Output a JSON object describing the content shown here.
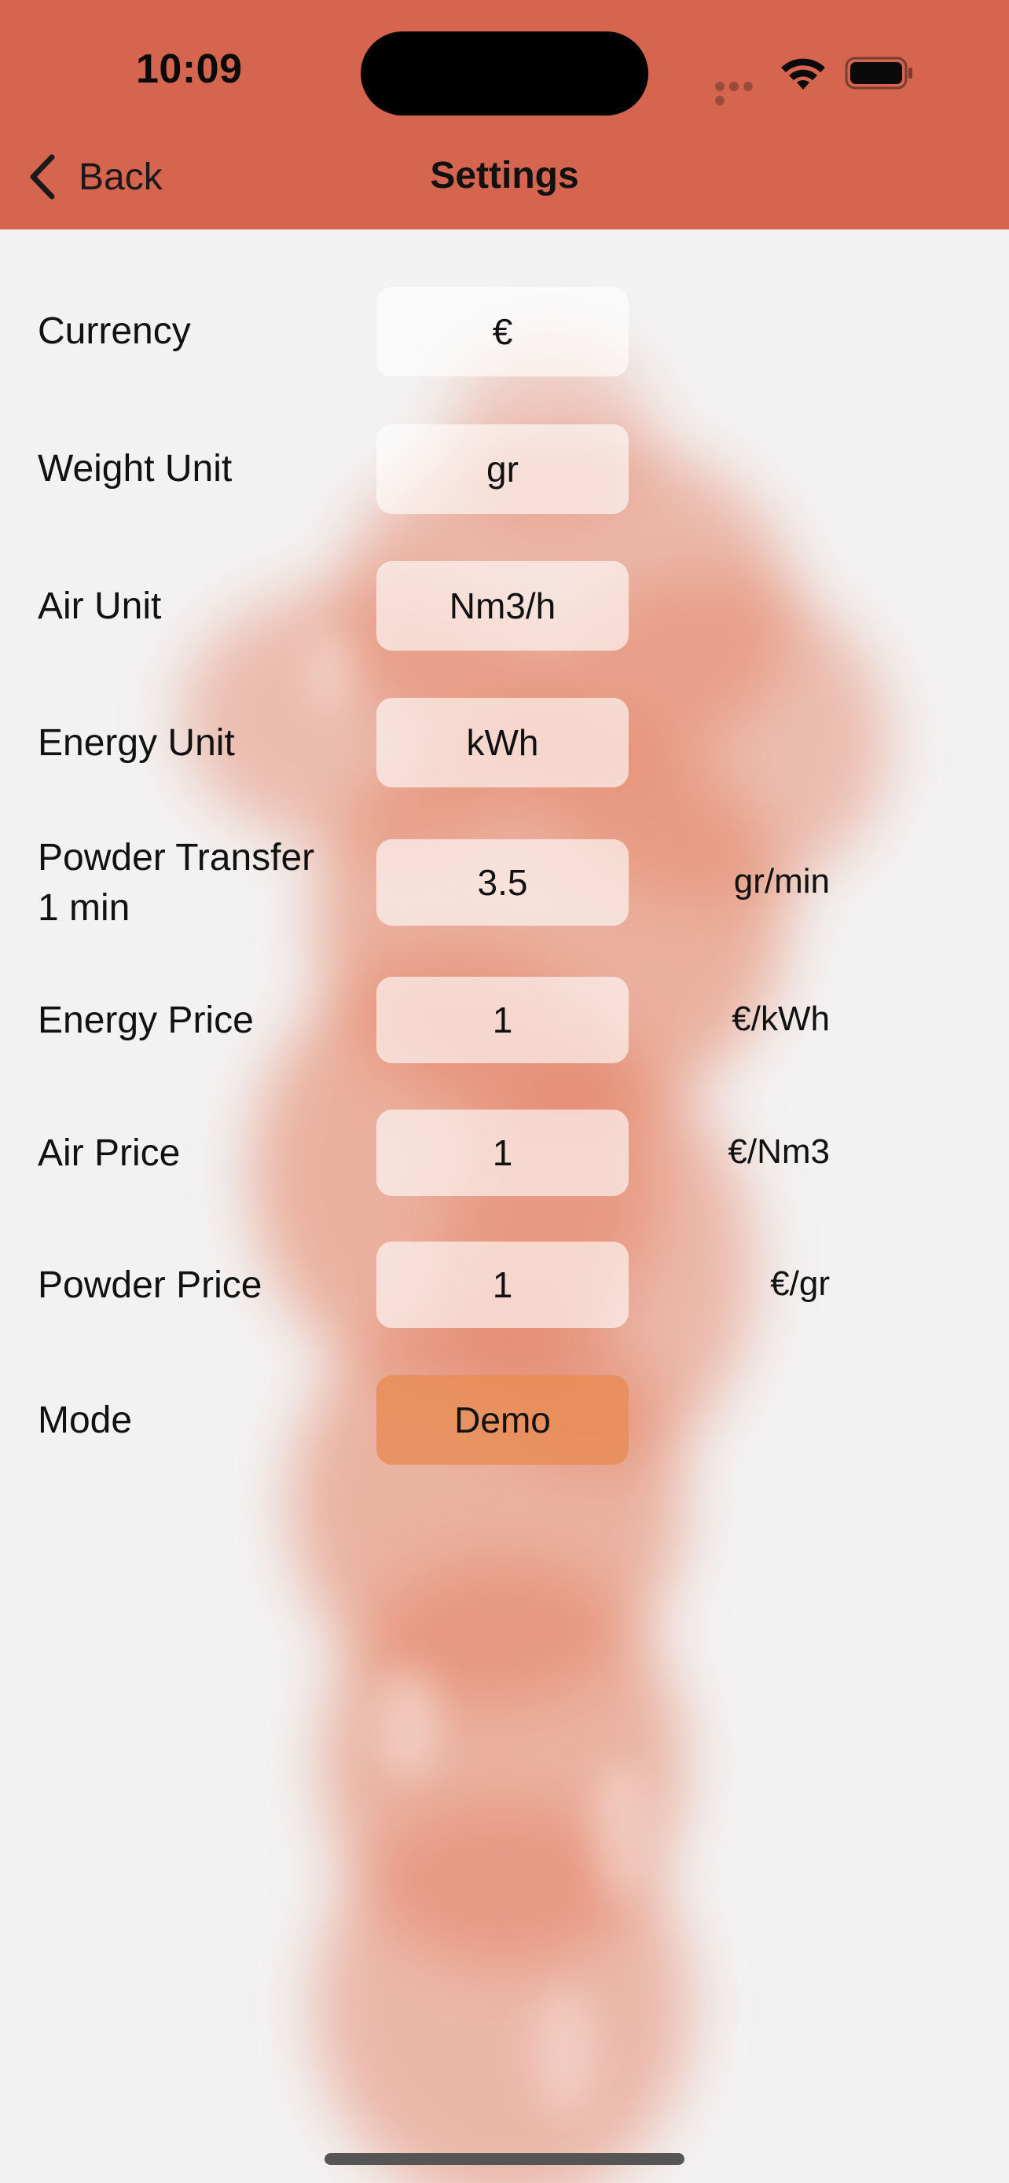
{
  "status_bar": {
    "time": "10:09"
  },
  "navbar": {
    "back_label": "Back",
    "title": "Settings"
  },
  "colors": {
    "header": "#d5654e",
    "background": "#f2f2f2",
    "mode_button": "#e88c55"
  },
  "icons": [
    "chevron-left-icon",
    "wifi-icon",
    "battery-icon",
    "cellular-icon"
  ],
  "settings": [
    {
      "label": "Currency",
      "value": "€",
      "unit": ""
    },
    {
      "label": "Weight Unit",
      "value": "gr",
      "unit": ""
    },
    {
      "label": "Air Unit",
      "value": "Nm3/h",
      "unit": ""
    },
    {
      "label": "Energy Unit",
      "value": "kWh",
      "unit": ""
    },
    {
      "label_line1": "Powder Transfer",
      "label_line2": "1 min",
      "value": "3.5",
      "unit": "gr/min"
    },
    {
      "label": "Energy Price",
      "value": "1",
      "unit": "€/kWh"
    },
    {
      "label": "Air Price",
      "value": "1",
      "unit": "€/Nm3"
    },
    {
      "label": "Powder Price",
      "value": "1",
      "unit": "€/gr"
    },
    {
      "label": "Mode",
      "value": "Demo",
      "unit": ""
    }
  ]
}
